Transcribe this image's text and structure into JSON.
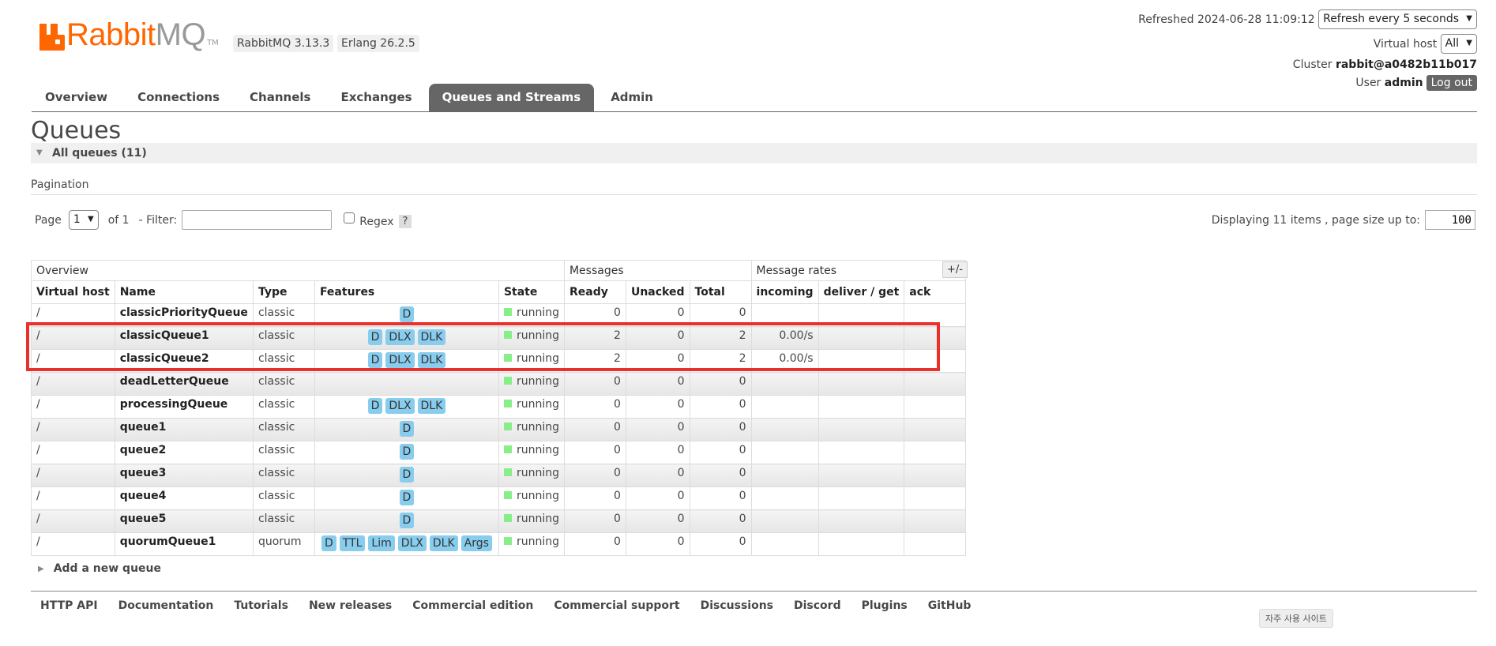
{
  "header": {
    "logo_main": "Rabbit",
    "logo_accent": "MQ",
    "logo_tm": "TM",
    "rabbitmq_version": "RabbitMQ 3.13.3",
    "erlang_version": "Erlang 26.2.5",
    "refreshed_label": "Refreshed",
    "refreshed_time": "2024-06-28 11:09:12",
    "refresh_select": "Refresh every 5 seconds",
    "vhost_label": "Virtual host",
    "vhost_select": "All",
    "cluster_label": "Cluster",
    "cluster_name": "rabbit@a0482b11b017",
    "user_label": "User",
    "user_name": "admin",
    "logout_label": "Log out"
  },
  "tabs": [
    {
      "label": "Overview",
      "active": false
    },
    {
      "label": "Connections",
      "active": false
    },
    {
      "label": "Channels",
      "active": false
    },
    {
      "label": "Exchanges",
      "active": false
    },
    {
      "label": "Queues and Streams",
      "active": true
    },
    {
      "label": "Admin",
      "active": false
    }
  ],
  "page": {
    "title": "Queues",
    "section_label": "All queues (11)",
    "pagination_label": "Pagination",
    "page_label": "Page",
    "page_value": "1",
    "of_label": "of 1",
    "filter_label": "- Filter:",
    "filter_value": "",
    "regex_label": "Regex",
    "help_label": "?",
    "display_label": "Displaying 11 items , page size up to:",
    "page_size": "100",
    "plus_minus": "+/-",
    "add_queue_label": "Add a new queue"
  },
  "table": {
    "groups": {
      "overview": "Overview",
      "messages": "Messages",
      "rates": "Message rates"
    },
    "columns": [
      "Virtual host",
      "Name",
      "Type",
      "Features",
      "State",
      "Ready",
      "Unacked",
      "Total",
      "incoming",
      "deliver / get",
      "ack"
    ],
    "rows": [
      {
        "vhost": "/",
        "name": "classicPriorityQueue",
        "type": "classic",
        "features": [
          "D"
        ],
        "state": "running",
        "ready": "0",
        "unacked": "0",
        "total": "0",
        "incoming": "",
        "deliver": "",
        "ack": ""
      },
      {
        "vhost": "/",
        "name": "classicQueue1",
        "type": "classic",
        "features": [
          "D",
          "DLX",
          "DLK"
        ],
        "state": "running",
        "ready": "2",
        "unacked": "0",
        "total": "2",
        "incoming": "0.00/s",
        "deliver": "",
        "ack": ""
      },
      {
        "vhost": "/",
        "name": "classicQueue2",
        "type": "classic",
        "features": [
          "D",
          "DLX",
          "DLK"
        ],
        "state": "running",
        "ready": "2",
        "unacked": "0",
        "total": "2",
        "incoming": "0.00/s",
        "deliver": "",
        "ack": ""
      },
      {
        "vhost": "/",
        "name": "deadLetterQueue",
        "type": "classic",
        "features": [],
        "state": "running",
        "ready": "0",
        "unacked": "0",
        "total": "0",
        "incoming": "",
        "deliver": "",
        "ack": ""
      },
      {
        "vhost": "/",
        "name": "processingQueue",
        "type": "classic",
        "features": [
          "D",
          "DLX",
          "DLK"
        ],
        "state": "running",
        "ready": "0",
        "unacked": "0",
        "total": "0",
        "incoming": "",
        "deliver": "",
        "ack": ""
      },
      {
        "vhost": "/",
        "name": "queue1",
        "type": "classic",
        "features": [
          "D"
        ],
        "state": "running",
        "ready": "0",
        "unacked": "0",
        "total": "0",
        "incoming": "",
        "deliver": "",
        "ack": ""
      },
      {
        "vhost": "/",
        "name": "queue2",
        "type": "classic",
        "features": [
          "D"
        ],
        "state": "running",
        "ready": "0",
        "unacked": "0",
        "total": "0",
        "incoming": "",
        "deliver": "",
        "ack": ""
      },
      {
        "vhost": "/",
        "name": "queue3",
        "type": "classic",
        "features": [
          "D"
        ],
        "state": "running",
        "ready": "0",
        "unacked": "0",
        "total": "0",
        "incoming": "",
        "deliver": "",
        "ack": ""
      },
      {
        "vhost": "/",
        "name": "queue4",
        "type": "classic",
        "features": [
          "D"
        ],
        "state": "running",
        "ready": "0",
        "unacked": "0",
        "total": "0",
        "incoming": "",
        "deliver": "",
        "ack": ""
      },
      {
        "vhost": "/",
        "name": "queue5",
        "type": "classic",
        "features": [
          "D"
        ],
        "state": "running",
        "ready": "0",
        "unacked": "0",
        "total": "0",
        "incoming": "",
        "deliver": "",
        "ack": ""
      },
      {
        "vhost": "/",
        "name": "quorumQueue1",
        "type": "quorum",
        "features": [
          "D",
          "TTL",
          "Lim",
          "DLX",
          "DLK",
          "Args"
        ],
        "state": "running",
        "ready": "0",
        "unacked": "0",
        "total": "0",
        "incoming": "",
        "deliver": "",
        "ack": ""
      }
    ]
  },
  "footer": {
    "links": [
      "HTTP API",
      "Documentation",
      "Tutorials",
      "New releases",
      "Commercial edition",
      "Commercial support",
      "Discussions",
      "Discord",
      "Plugins",
      "GitHub"
    ]
  },
  "overlay_tag": "자주 사용 사이트",
  "colors": {
    "brand": "#ff6600",
    "active_tab": "#666666",
    "badge": "#88ccee",
    "running": "#88ee88",
    "highlight": "#e8302c"
  }
}
